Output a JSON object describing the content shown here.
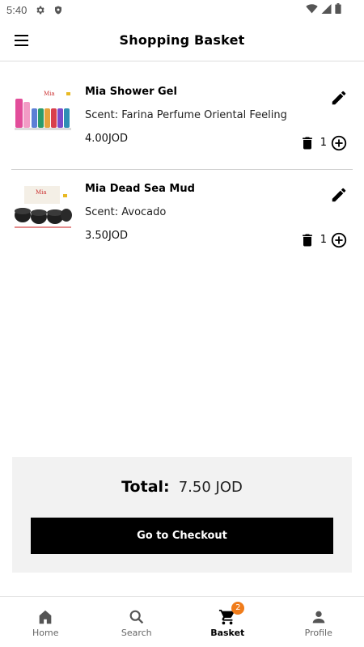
{
  "status_bar": {
    "time": "5:40"
  },
  "app_bar": {
    "title": "Shopping Basket"
  },
  "basket": {
    "items": [
      {
        "name": "Mia Shower Gel",
        "scent": "Scent: Farina Perfume Oriental Feeling",
        "price": "4.00JOD",
        "quantity": "1"
      },
      {
        "name": "Mia Dead Sea Mud",
        "scent": "Scent: Avocado",
        "price": "3.50JOD",
        "quantity": "1"
      }
    ]
  },
  "summary": {
    "total_label": "Total:",
    "total_value": "7.50 JOD",
    "checkout_label": "Go to Checkout"
  },
  "bottom_nav": {
    "items": [
      {
        "label": "Home",
        "icon": "home-icon"
      },
      {
        "label": "Search",
        "icon": "search-icon"
      },
      {
        "label": "Basket",
        "icon": "cart-icon",
        "badge": "2",
        "active": true
      },
      {
        "label": "Profile",
        "icon": "person-icon"
      }
    ]
  },
  "colors": {
    "accent_badge": "#f07c1b",
    "checkout_bg": "#000000",
    "panel_bg": "#f2f2f2"
  }
}
